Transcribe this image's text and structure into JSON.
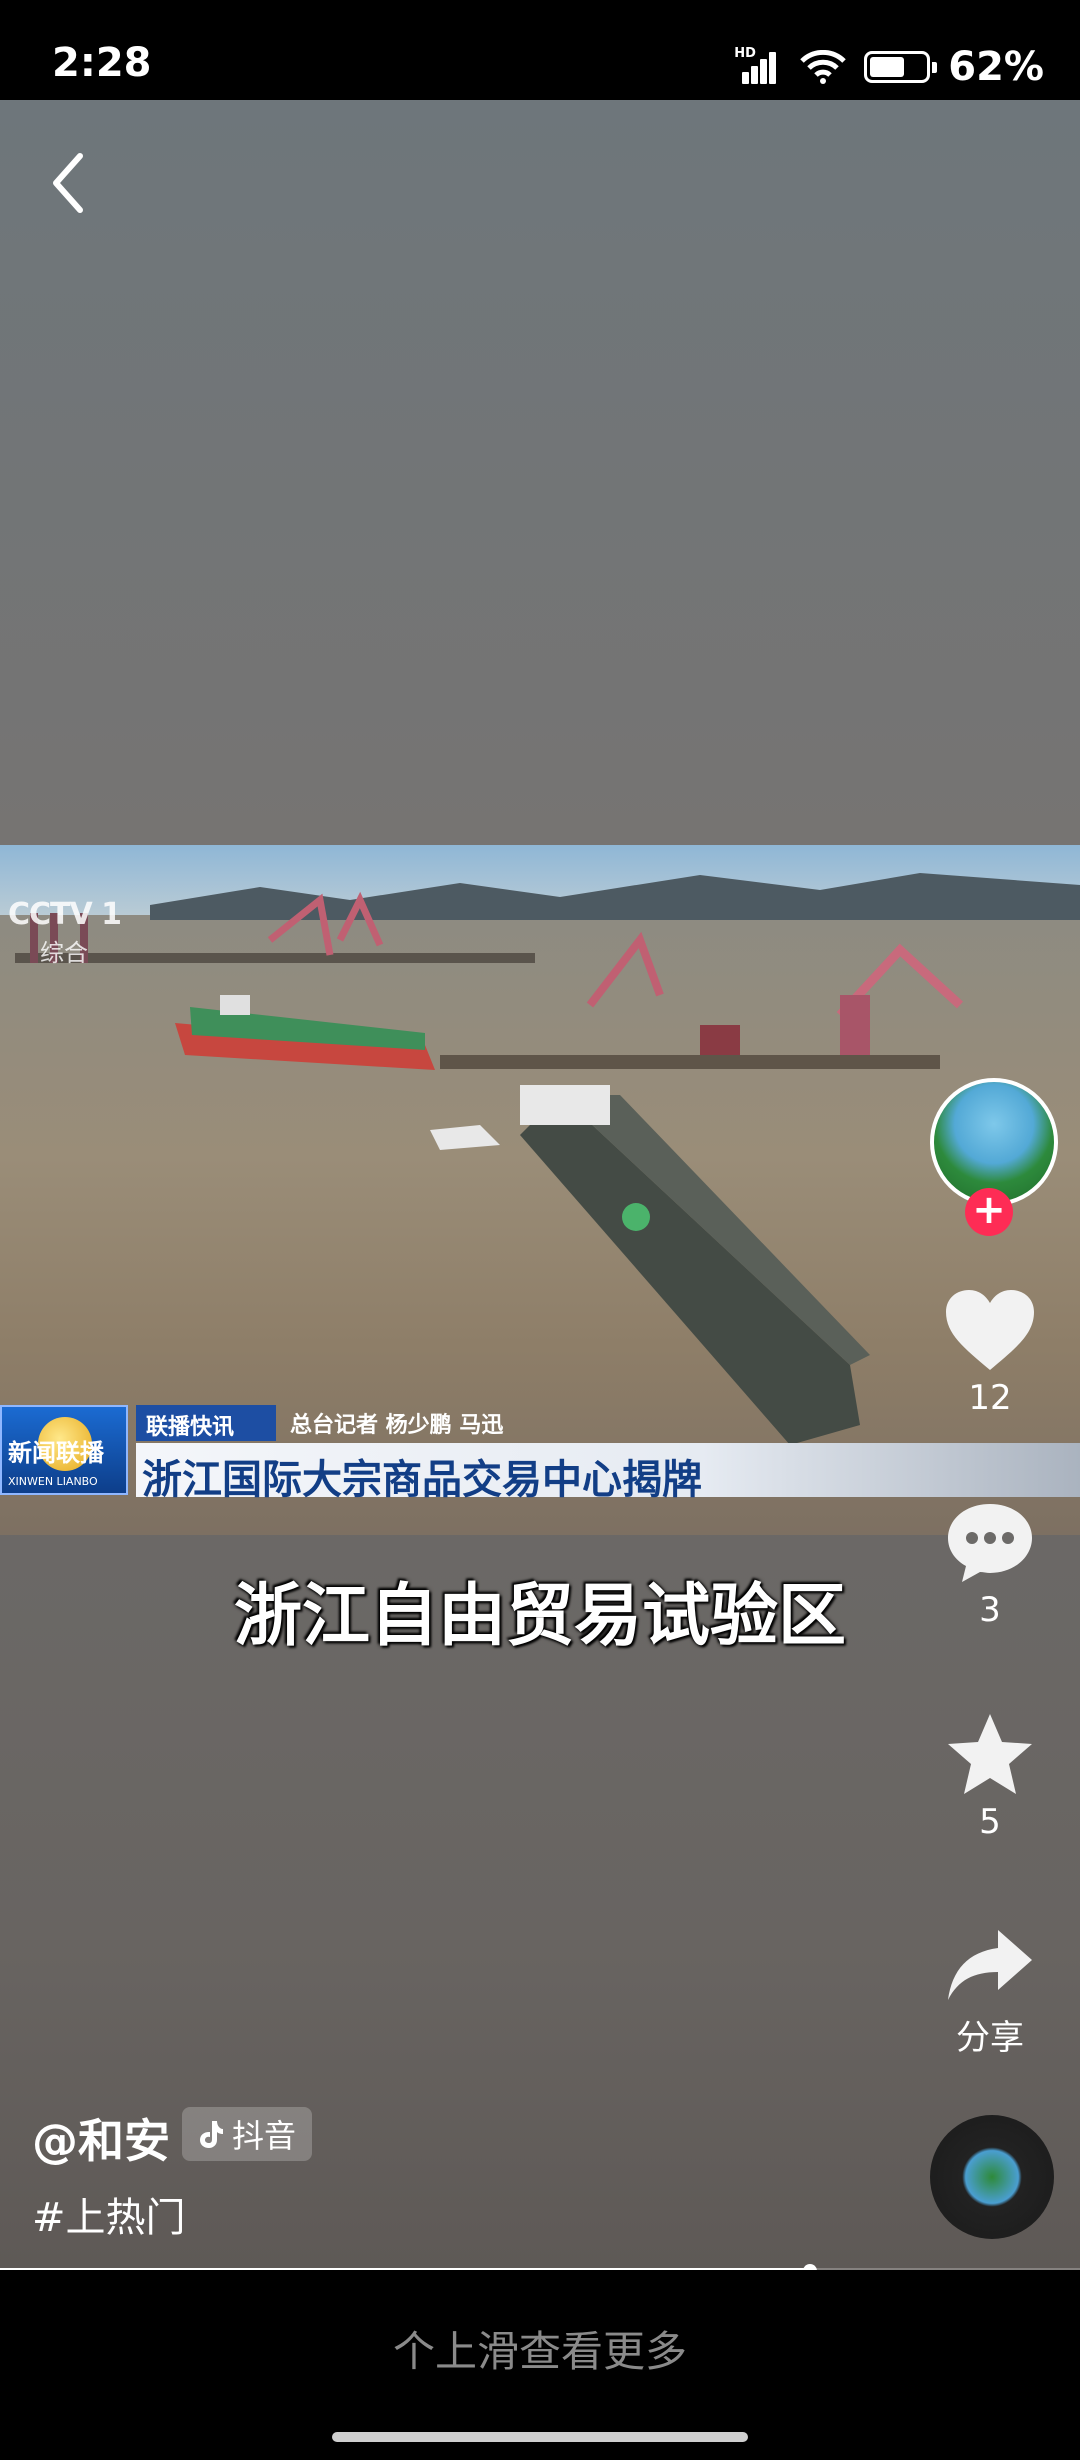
{
  "status_bar": {
    "time": "2:28",
    "network": "HD",
    "battery_percent_label": "62%",
    "battery_level": 0.62
  },
  "news_frame": {
    "channel_logo": "CCTV 1",
    "channel_sub": "综合",
    "program_logo": "新闻联播",
    "program_logo_en": "XINWEN LIANBO",
    "tag": "联播快讯",
    "reporters": "总台记者 杨少鹏 马迅",
    "headline": "浙江国际大宗商品交易中心揭牌"
  },
  "subtitle": "浙江自由贸易试验区",
  "actions": {
    "like_count": "12",
    "comment_count": "3",
    "favorite_count": "5",
    "share_label": "分享"
  },
  "author": "@和安",
  "platform_badge": "抖音",
  "hashtag": "#上热门",
  "progress": 0.75,
  "swipe_hint": "个上滑查看更多",
  "colors": {
    "follow": "#fe2c55",
    "headline_blue": "#123e86"
  }
}
